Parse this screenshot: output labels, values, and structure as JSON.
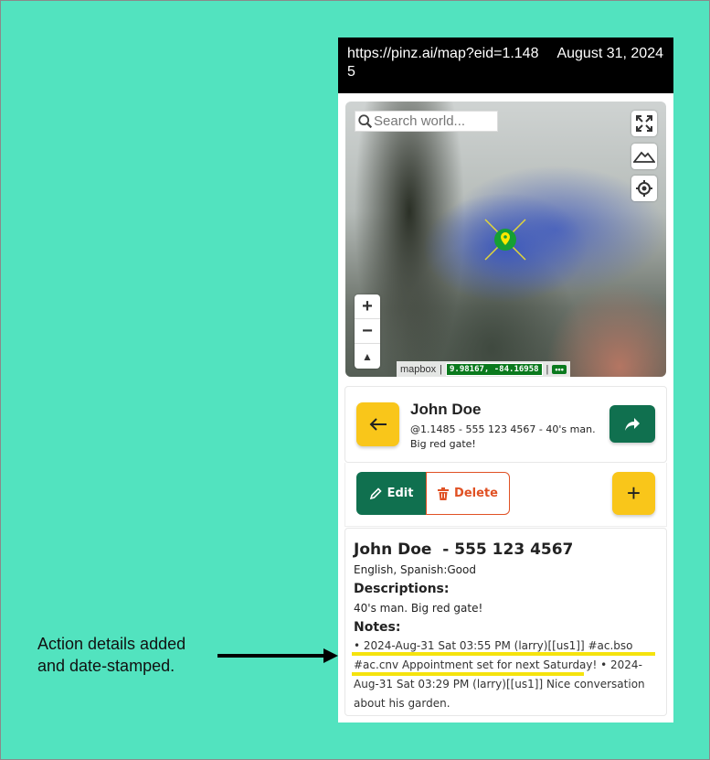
{
  "browser": {
    "url": "https://pinz.ai/map?eid=1.1485",
    "date": "August 31, 2024"
  },
  "map": {
    "search_placeholder": "Search world...",
    "attribution": "mapbox",
    "separator": "|",
    "coordinates": "9.98167, -84.16958",
    "more_label": "•••",
    "zoom_in": "+",
    "zoom_out": "−",
    "compass": "▲"
  },
  "contact": {
    "name": "John Doe",
    "subtitle": "@1.1485 - 555 123 4567 - 40's man. Big red gate!"
  },
  "actions": {
    "edit_label": "Edit",
    "delete_label": "Delete",
    "add_label": "+"
  },
  "detail": {
    "title": "John Doe  - 555 123 4567",
    "languages": "English, Spanish:Good",
    "descriptions_heading": "Descriptions:",
    "description": "40's man. Big red gate!",
    "notes_heading": "Notes:",
    "notes": "• 2024-Aug-31 Sat 03:55 PM (larry)[[us1]] #ac.bso #ac.cnv Appointment set for next Saturday! • 2024-Aug-31 Sat 03:29 PM (larry)[[us1]] Nice conversation about his garden."
  },
  "annotation": {
    "callout_line1": "Action details added",
    "callout_line2": "and date-stamped."
  },
  "colors": {
    "background": "#52e3bf",
    "primary_green": "#10704f",
    "accent_yellow": "#f9c61a",
    "delete_red": "#e05124",
    "highlight": "#f5e30d"
  }
}
